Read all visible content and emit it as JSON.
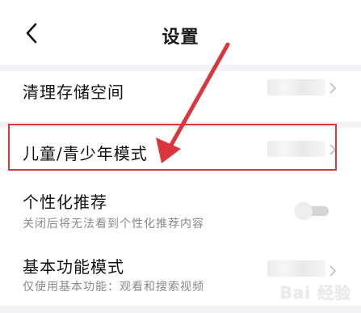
{
  "header": {
    "title": "设置",
    "back_icon": "chevron-left-icon"
  },
  "settings": {
    "storage": {
      "label": "清理存储空间"
    },
    "youth_mode": {
      "label": "儿童/青少年模式"
    },
    "personalized": {
      "label": "个性化推荐",
      "description": "关闭后将无法看到个性化推荐内容",
      "enabled": false
    },
    "basic_mode": {
      "label": "基本功能模式",
      "description": "仅使用基本功能：观看和搜索视频"
    }
  },
  "annotation": {
    "color": "#d9373d"
  },
  "watermark": {
    "text": "Bai 经验"
  }
}
